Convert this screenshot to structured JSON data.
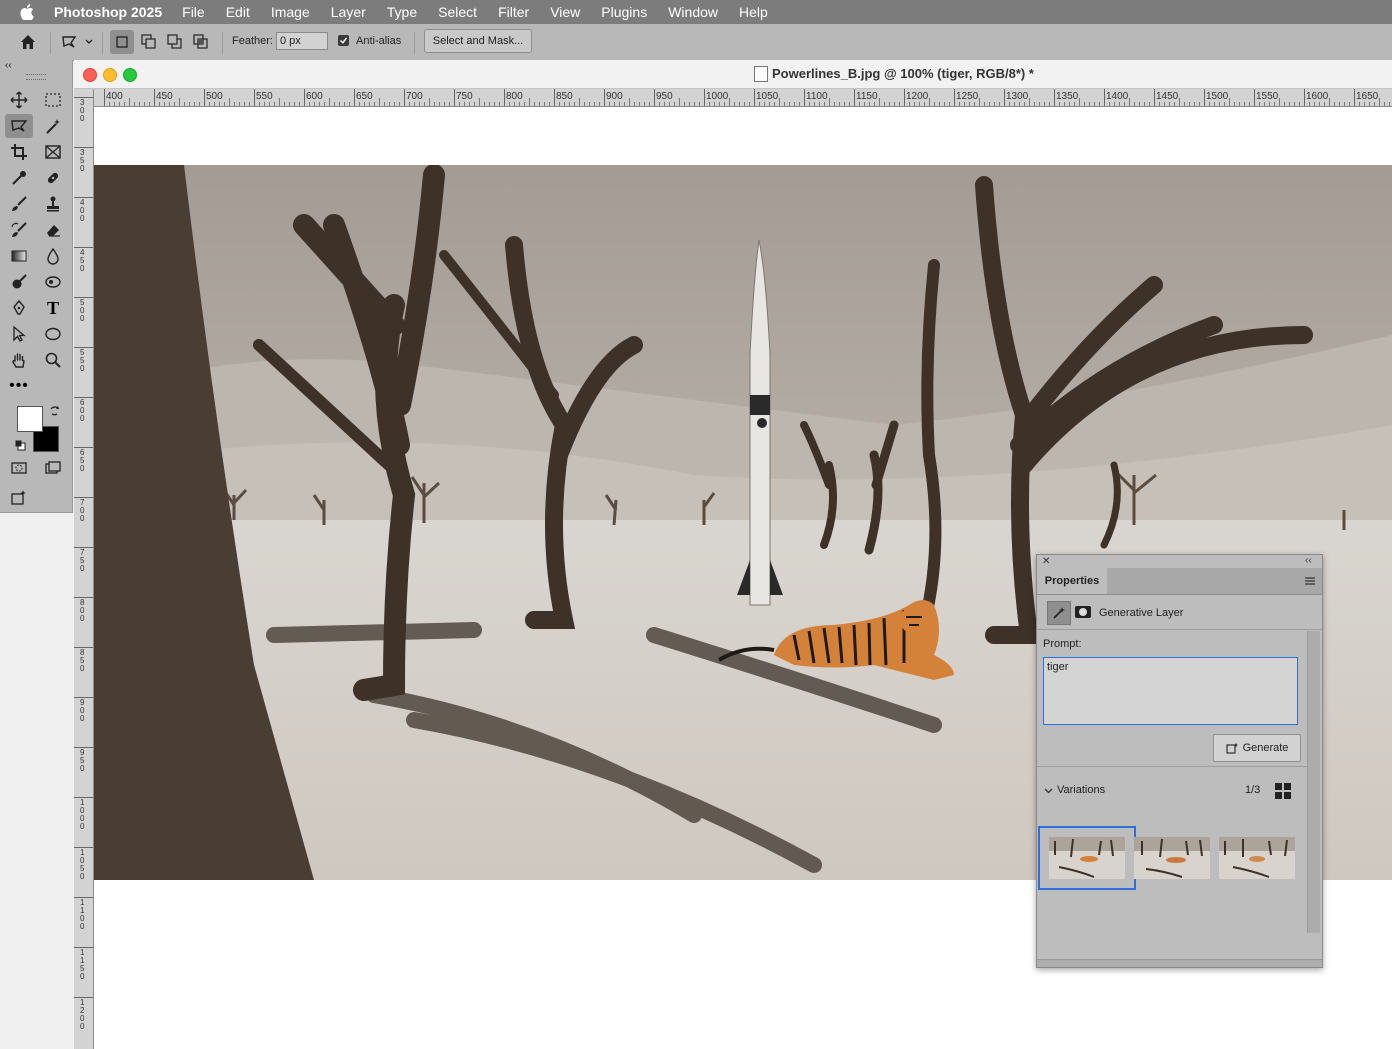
{
  "menubar": {
    "app_name": "Photoshop 2025",
    "items": [
      "File",
      "Edit",
      "Image",
      "Layer",
      "Type",
      "Select",
      "Filter",
      "View",
      "Plugins",
      "Window",
      "Help"
    ]
  },
  "options_bar": {
    "feather_label": "Feather:",
    "feather_value": "0 px",
    "antialias_label": "Anti-alias",
    "antialias_checked": true,
    "select_mask_label": "Select and Mask..."
  },
  "document": {
    "title": "Powerlines_B.jpg @ 100% (tiger, RGB/8*) *",
    "ruler_h": [
      "400",
      "450",
      "500",
      "550",
      "600",
      "650",
      "700",
      "750",
      "800",
      "850",
      "900",
      "950",
      "1000",
      "1050",
      "1100",
      "1150",
      "1200",
      "1250",
      "1300",
      "1350",
      "1400",
      "1450",
      "1500",
      "1550",
      "1600",
      "1650"
    ],
    "ruler_v": [
      "3 0 0",
      "3 5 0",
      "4 0 0",
      "4 5 0",
      "5 0 0",
      "5 5 0",
      "6 0 0",
      "6 5 0",
      "7 0 0",
      "7 5 0",
      "8 0 0",
      "8 5 0",
      "9 0 0",
      "9 5 0",
      "1 0 0 0",
      "1 0 5 0",
      "1 1 0 0",
      "1 1 5 0",
      "1 2 0 0"
    ]
  },
  "properties": {
    "tab_label": "Properties",
    "layer_type": "Generative Layer",
    "prompt_label": "Prompt:",
    "prompt_value": "tiger",
    "generate_label": "Generate",
    "variations_label": "Variations",
    "variations_count": "1/3",
    "selected_variation": 1
  },
  "colors": {
    "accent": "#2f6fd6",
    "menubar_bg": "#7c7c7c",
    "panel_bg": "#b8b8b8",
    "foreground": "#ffffff",
    "background": "#000000"
  },
  "icons": {
    "tools": [
      "move-icon",
      "marquee-icon",
      "lasso-icon",
      "magic-wand-icon",
      "crop-icon",
      "frame-icon",
      "eyedropper-icon",
      "healing-brush-icon",
      "brush-icon",
      "stamp-icon",
      "history-brush-icon",
      "eraser-icon",
      "gradient-icon",
      "blur-icon",
      "dodge-icon",
      "smudge-icon",
      "pen-icon",
      "type-icon",
      "path-select-icon",
      "ellipse-icon",
      "hand-icon",
      "zoom-icon",
      "more-tools-icon"
    ]
  }
}
